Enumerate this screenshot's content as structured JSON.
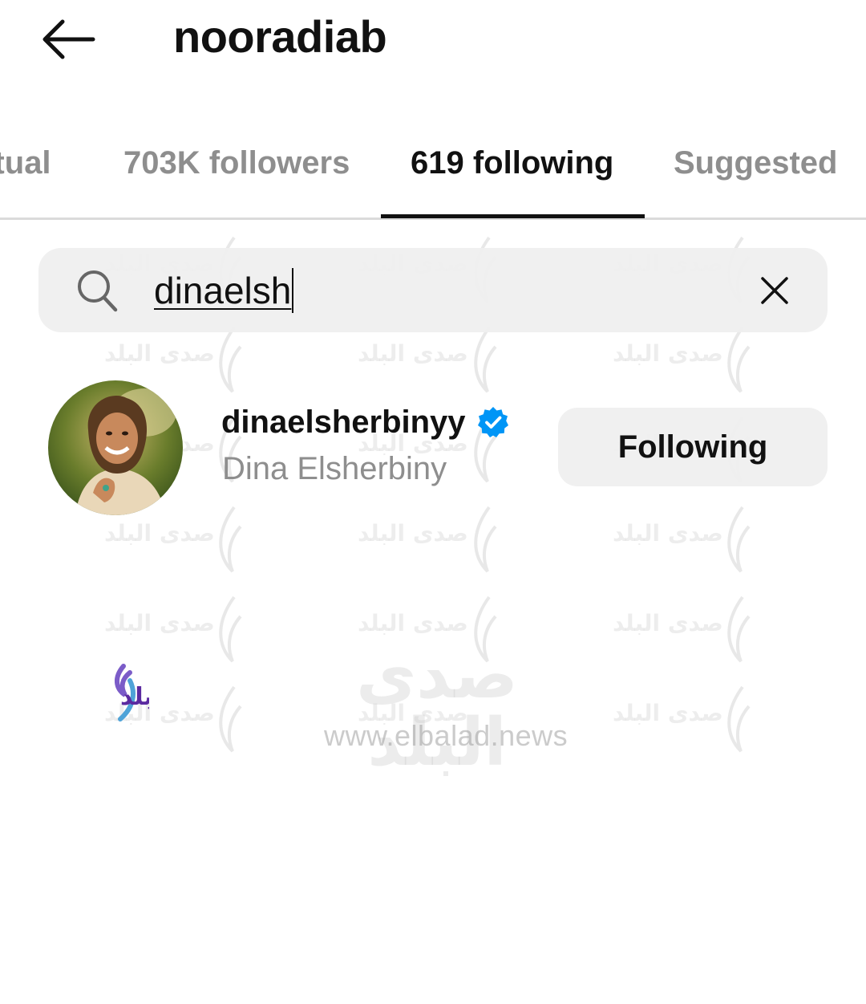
{
  "header": {
    "title": "nooradiab",
    "back_icon": "arrow-left-icon"
  },
  "tabs": [
    {
      "label": "Mutual",
      "visible_label": "utual",
      "active": false
    },
    {
      "label": "703K followers",
      "active": false
    },
    {
      "label": "619 following",
      "active": true
    },
    {
      "label": "Suggested",
      "active": false
    }
  ],
  "search": {
    "value": "dinaelsh",
    "icon": "search-icon",
    "clear_icon": "close-icon"
  },
  "results": [
    {
      "username": "dinaelsherbinyy",
      "full_name": "Dina Elsherbiny",
      "verified": true,
      "button_label": "Following"
    }
  ],
  "watermark": {
    "arabic": "صدى البلد",
    "url": "www.elbalad.news"
  },
  "colors": {
    "primary_text": "#111111",
    "secondary_text": "#8e8e8e",
    "button_bg": "#efefef",
    "verified_blue": "#0095f6",
    "logo_purple": "#5b2aa0"
  }
}
